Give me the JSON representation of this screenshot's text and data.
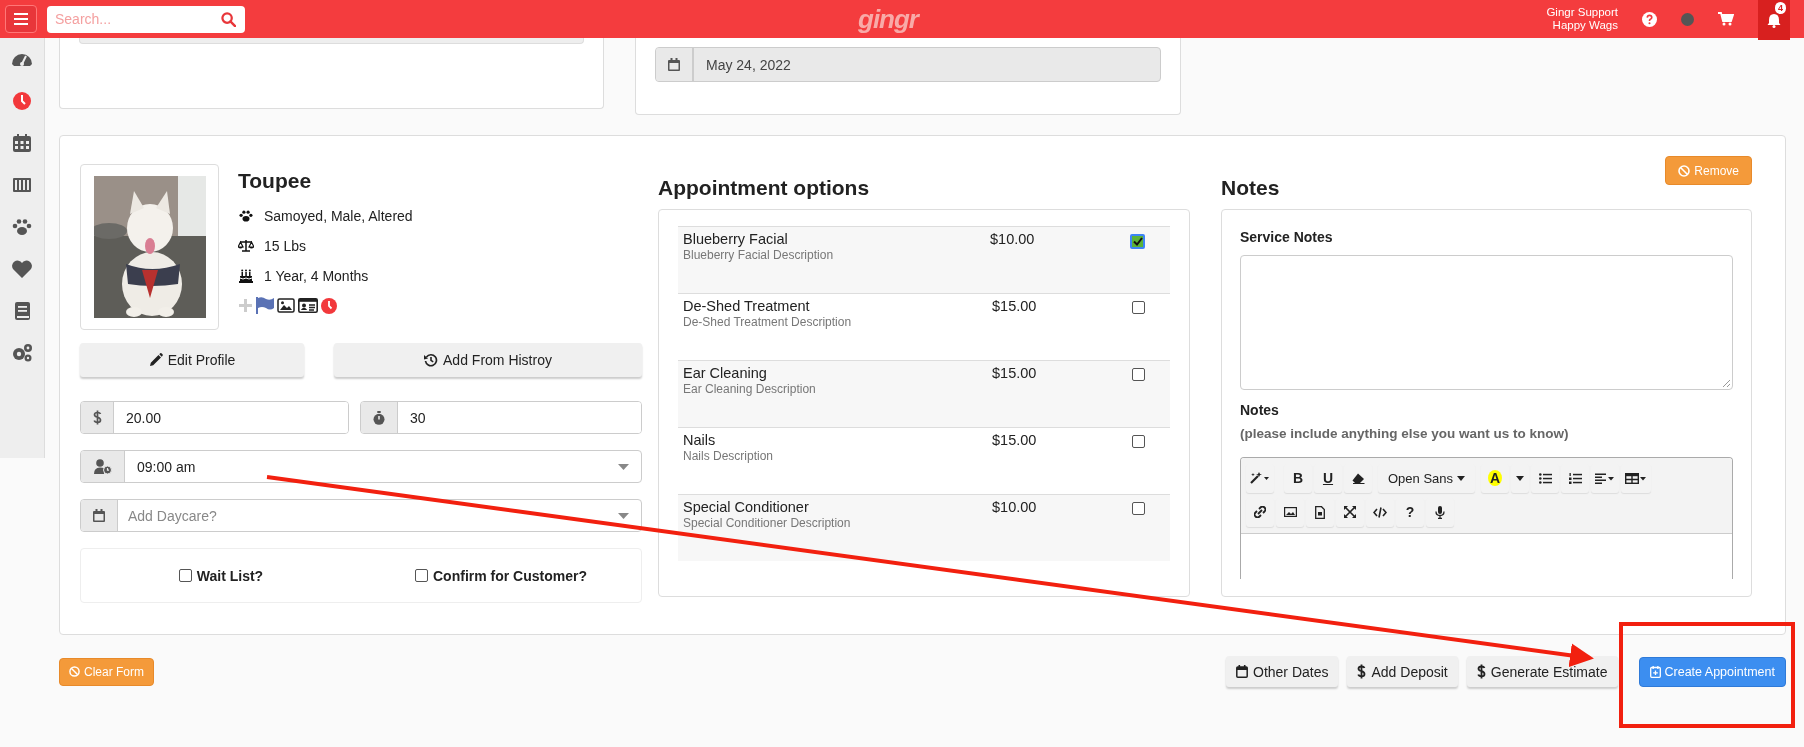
{
  "top_bar": {
    "search": {
      "placeholder": "Search..."
    },
    "logo": "gingr",
    "user": {
      "name": "Gingr Support",
      "location": "Happy Wags"
    },
    "notification_count": "4"
  },
  "sidebar": {
    "items": [
      {
        "selected": false
      },
      {
        "selected": true
      },
      {
        "selected": false
      },
      {
        "selected": false
      },
      {
        "selected": false
      },
      {
        "selected": false
      },
      {
        "selected": false
      },
      {
        "selected": false
      }
    ]
  },
  "date_field": {
    "value": "May 24, 2022"
  },
  "pet": {
    "name": "Toupee",
    "details": "Samoyed, Male, Altered",
    "weight": "15 Lbs",
    "age": "1 Year, 4 Months"
  },
  "pet_buttons": [
    "Edit Profile",
    "Add From Histroy"
  ],
  "price": {
    "value": "20.00"
  },
  "duration": {
    "value": "30"
  },
  "time_select": {
    "value": "09:00 am"
  },
  "daycare_select": {
    "placeholder": "Add Daycare?"
  },
  "checkboxes": [
    {
      "label": "Wait List?",
      "checked": false
    },
    {
      "label": "Confirm for Customer?",
      "checked": false
    }
  ],
  "appointment_options": {
    "title": "Appointment options",
    "rows": [
      {
        "name": "Blueberry Facial",
        "description": "Blueberry Facial Description",
        "price": "$10.00",
        "checked": true
      },
      {
        "name": "De-Shed Treatment",
        "description": "De-Shed Treatment Description",
        "price": "$15.00",
        "checked": false
      },
      {
        "name": "Ear Cleaning",
        "description": "Ear Cleaning Description",
        "price": "$15.00",
        "checked": false
      },
      {
        "name": "Nails",
        "description": "Nails Description",
        "price": "$15.00",
        "checked": false
      },
      {
        "name": "Special Conditioner",
        "description": "Special Conditioner Description",
        "price": "$10.00",
        "checked": false
      }
    ]
  },
  "notes": {
    "title": "Notes",
    "remove_button": "Remove",
    "service_notes_label": "Service Notes",
    "notes_label": "Notes",
    "notes_hint": "(please include anything else you want us to know)",
    "toolbar": {
      "bold": "B",
      "underline": "U",
      "font": "Open Sans",
      "highlight": "A",
      "help": "?"
    }
  },
  "footer": {
    "clear_button": "Clear Form",
    "buttons": [
      "Other Dates",
      "Add Deposit",
      "Generate Estimate"
    ],
    "primary_button": "Create Appointment"
  }
}
